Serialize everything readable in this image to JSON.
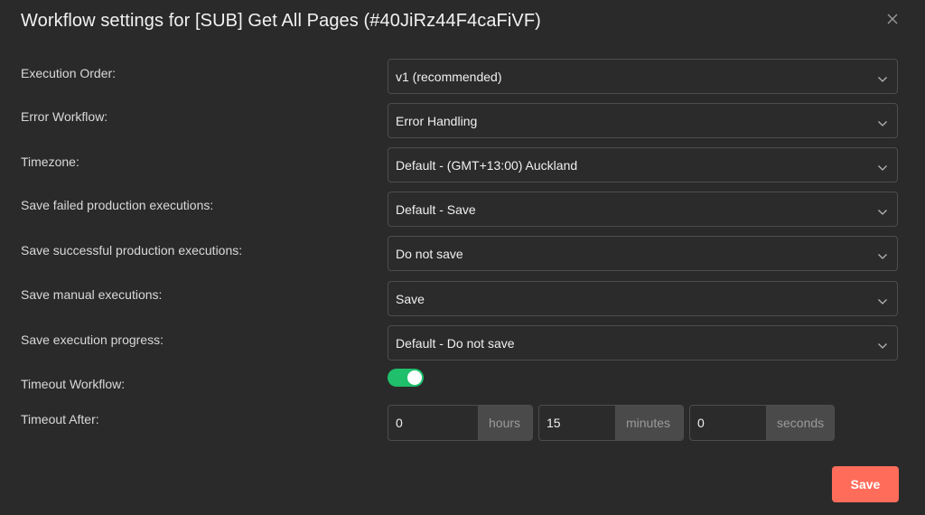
{
  "dialog": {
    "title": "Workflow settings for [SUB] Get All Pages (#40JiRz44F4caFiVF)"
  },
  "settings": {
    "execution_order": {
      "label": "Execution Order:",
      "value": "v1 (recommended)"
    },
    "error_workflow": {
      "label": "Error Workflow:",
      "value": "Error Handling"
    },
    "timezone": {
      "label": "Timezone:",
      "value": "Default - (GMT+13:00) Auckland"
    },
    "save_failed": {
      "label": "Save failed production executions:",
      "value": "Default - Save"
    },
    "save_successful": {
      "label": "Save successful production executions:",
      "value": "Do not save"
    },
    "save_manual": {
      "label": "Save manual executions:",
      "value": "Save"
    },
    "save_progress": {
      "label": "Save execution progress:",
      "value": "Default - Do not save"
    },
    "timeout_workflow": {
      "label": "Timeout Workflow:",
      "enabled": true
    },
    "timeout_after": {
      "label": "Timeout After:",
      "hours": {
        "value": "0",
        "unit": "hours"
      },
      "minutes": {
        "value": "15",
        "unit": "minutes"
      },
      "seconds": {
        "value": "0",
        "unit": "seconds"
      }
    }
  },
  "actions": {
    "save_label": "Save"
  },
  "colors": {
    "background": "#2a2a2a",
    "accent": "#ff6d5a",
    "toggle_on": "#1fbf6b"
  },
  "icons": {
    "close": "close-icon",
    "dropdown": "chevron-down-icon"
  }
}
